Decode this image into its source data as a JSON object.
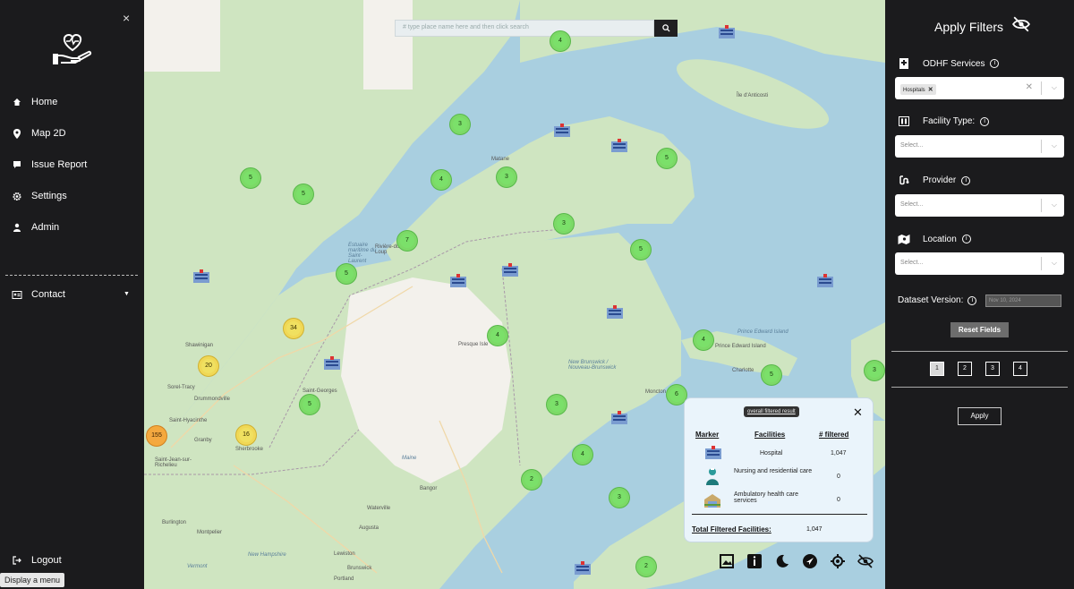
{
  "sidebar": {
    "close_glyph": "×",
    "logo_icon": "heart-hand-icon",
    "nav": [
      {
        "label": "Home",
        "icon": "home-icon"
      },
      {
        "label": "Map 2D",
        "icon": "map-pin-icon"
      },
      {
        "label": "Issue Report",
        "icon": "flag-icon"
      },
      {
        "label": "Settings",
        "icon": "gear-icon"
      },
      {
        "label": "Admin",
        "icon": "user-icon"
      }
    ],
    "contact_label": "Contact",
    "logout_label": "Logout",
    "tooltip": "Display a menu"
  },
  "map": {
    "search_placeholder": "# type place name here and then click search",
    "search_button_icon": "search-icon",
    "clusters": [
      {
        "count": "4",
        "tone": "green"
      },
      {
        "count": "3",
        "tone": "green"
      },
      {
        "count": "3",
        "tone": "green"
      },
      {
        "count": "4",
        "tone": "green"
      },
      {
        "count": "5",
        "tone": "green"
      },
      {
        "count": "5",
        "tone": "green"
      },
      {
        "count": "5",
        "tone": "green"
      },
      {
        "count": "3",
        "tone": "green"
      },
      {
        "count": "7",
        "tone": "green"
      },
      {
        "count": "5",
        "tone": "green"
      },
      {
        "count": "5",
        "tone": "green"
      },
      {
        "count": "34",
        "tone": "yellow"
      },
      {
        "count": "20",
        "tone": "yellow"
      },
      {
        "count": "4",
        "tone": "green"
      },
      {
        "count": "4",
        "tone": "green"
      },
      {
        "count": "5",
        "tone": "green"
      },
      {
        "count": "6",
        "tone": "green"
      },
      {
        "count": "3",
        "tone": "green"
      },
      {
        "count": "3",
        "tone": "green"
      },
      {
        "count": "5",
        "tone": "green"
      },
      {
        "count": "16",
        "tone": "yellow"
      },
      {
        "count": "155",
        "tone": "orange"
      },
      {
        "count": "4",
        "tone": "green"
      },
      {
        "count": "2",
        "tone": "green"
      },
      {
        "count": "3",
        "tone": "green"
      },
      {
        "count": "2",
        "tone": "green"
      }
    ],
    "places": [
      "Île d'Anticosti",
      "Matane",
      "Prince Edward Island",
      "Prince Edward Island",
      "Charlotte",
      "Shawinigan",
      "Sorel-Tracy",
      "Drummondville",
      "Saint-Hyacinthe",
      "Granby",
      "Saint-Jean-sur-Richelieu",
      "Sherbrooke",
      "Saint-Georges",
      "Presque Isle",
      "New Brunswick / Nouveau-Brunswick",
      "Moncton",
      "Maine",
      "Bangor",
      "Waterville",
      "Augusta",
      "Lewiston",
      "Brunswick",
      "Portland",
      "Burlington",
      "Montpelier",
      "Vermont",
      "New Hampshire",
      "Rivière-du-Loup",
      "Estuaire maritime du Saint-Laurent"
    ]
  },
  "popup": {
    "pill": "overall filtered result",
    "close": "✕",
    "headers": {
      "marker": "Marker",
      "facilities": "Facilities",
      "filtered": "# filtered"
    },
    "rows": [
      {
        "icon": "hospital-icon",
        "facility": "Hospital",
        "count": "1,047"
      },
      {
        "icon": "nurse-icon",
        "facility": "Nursing and residential care",
        "count": "0"
      },
      {
        "icon": "ambulatory-icon",
        "facility": "Ambulatory health care services",
        "count": "0"
      }
    ],
    "total_label": "Total Filtered Facilities:",
    "total_value": "1,047"
  },
  "toolbar": [
    "image-icon",
    "info-icon",
    "moon-icon",
    "navigate-icon",
    "locate-icon",
    "eye-off-icon"
  ],
  "filters": {
    "title": "Apply Filters",
    "title_icon": "eye-off-icon",
    "odhf": {
      "label": "ODHF Services",
      "tag": "Hospitals"
    },
    "facility_type": {
      "label": "Facility Type:",
      "placeholder": "Select..."
    },
    "provider": {
      "label": "Provider",
      "placeholder": "Select..."
    },
    "location": {
      "label": "Location",
      "placeholder": "Select..."
    },
    "dataset": {
      "label": "Dataset Version:",
      "value": "Nov 10, 2024"
    },
    "reset_label": "Reset Fields",
    "pages": [
      "1",
      "2",
      "3",
      "4"
    ],
    "active_page": "1",
    "apply_label": "Apply"
  },
  "colors": {
    "sidebar_bg": "#1b1b1d",
    "cluster_green": "#7be06a",
    "cluster_yellow": "#f0e060",
    "cluster_orange": "#f4a840",
    "water": "#a9cfe0",
    "land": "#cfe5c1"
  }
}
